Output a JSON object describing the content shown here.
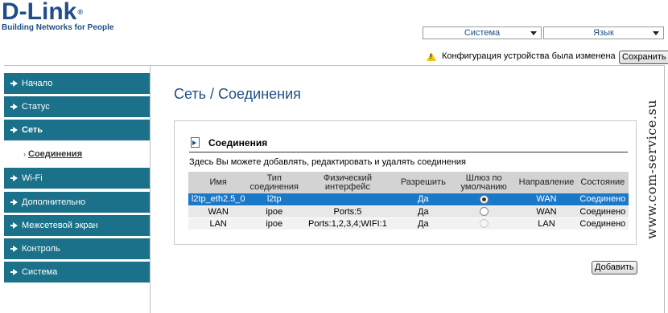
{
  "brand": {
    "name": "D-Link",
    "reg": "®",
    "tagline": "Building Networks for People"
  },
  "header": {
    "system_dropdown": "Система",
    "language_dropdown": "Язык",
    "warning_text": "Конфигурация устройства была изменена",
    "save_button": "Сохранить"
  },
  "sidebar": {
    "items": [
      {
        "label": "Начало"
      },
      {
        "label": "Статус"
      },
      {
        "label": "Сеть"
      },
      {
        "label": "Wi-Fi"
      },
      {
        "label": "Дополнительно"
      },
      {
        "label": "Межсетевой экран"
      },
      {
        "label": "Контроль"
      },
      {
        "label": "Система"
      }
    ],
    "sub_item": "Соединения"
  },
  "page": {
    "title": "Сеть  / Соединения",
    "panel_title": "Соединения",
    "description": "Здесь Вы можете добавлять, редактировать и удалять соединения",
    "add_button": "Добавить"
  },
  "table": {
    "headers": [
      "Имя",
      "Тип соединения",
      "Физический интерфейс",
      "Разрешить",
      "Шлюз по умолчанию",
      "Направление",
      "Состояние"
    ],
    "rows": [
      {
        "name": "l2tp_eth2.5_0",
        "type": "l2tp",
        "iface": "",
        "enabled": "Да",
        "gateway": "checked",
        "direction": "WAN",
        "state": "Соединено"
      },
      {
        "name": "WAN",
        "type": "ipoe",
        "iface": "Ports:5",
        "enabled": "Да",
        "gateway": "unchecked",
        "direction": "WAN",
        "state": "Соединено"
      },
      {
        "name": "LAN",
        "type": "ipoe",
        "iface": "Ports:1,2,3,4;WIFI:1",
        "enabled": "Да",
        "gateway": "disabled",
        "direction": "LAN",
        "state": "Соединено"
      }
    ]
  },
  "watermark": "www.com-service.su"
}
